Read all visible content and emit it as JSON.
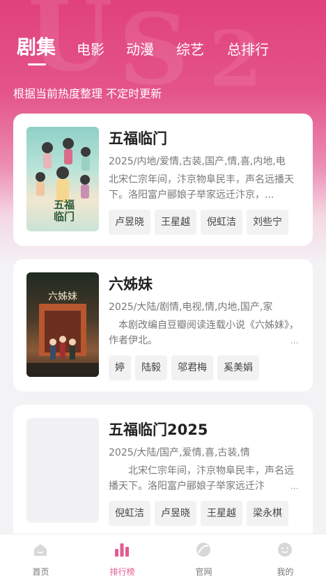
{
  "tabs": [
    {
      "label": "剧集",
      "active": true
    },
    {
      "label": "电影",
      "active": false
    },
    {
      "label": "动漫",
      "active": false
    },
    {
      "label": "综艺",
      "active": false
    },
    {
      "label": "总排行",
      "active": false
    }
  ],
  "subtitle": "根据当前热度整理 不定时更新",
  "accent_color": "#e0417c",
  "cards": [
    {
      "title": "五福临门",
      "meta": "2025/内地/爱情,古装,国产,情,喜,内地,电",
      "description": "北宋仁宗年间，汴京物阜民丰，声名远播天下。洛阳富户郦娘子举家远迁汴京，...",
      "actors": [
        "卢昱晓",
        "王星越",
        "倪虹洁",
        "刘些宁"
      ],
      "poster_text": "五福临门"
    },
    {
      "title": "六姊妹",
      "meta": "2025/大陆/剧情,电视,情,内地,国产,家",
      "description": "本剧改编自豆瓣阅读连载小说《六姊妹》，作者伊北。",
      "ellipsis": "...",
      "actors": [
        "婷",
        "陆毅",
        "邬君梅",
        "奚美娟"
      ],
      "poster_text": "六姊妹"
    },
    {
      "title": "五福临门2025",
      "meta": "2025/大陆/国产,爱情,喜,古装,情",
      "description": "北宋仁宗年间，汴京物阜民丰，声名远播天下。洛阳富户郦娘子举家远迁汴",
      "ellipsis": "...",
      "actors": [
        "倪虹洁",
        "卢昱晓",
        "王星越",
        "梁永棋"
      ]
    }
  ],
  "bottom_nav": [
    {
      "label": "首页",
      "icon": "home-icon",
      "active": false
    },
    {
      "label": "排行榜",
      "icon": "ranking-icon",
      "active": true
    },
    {
      "label": "官网",
      "icon": "official-site-icon",
      "active": false
    },
    {
      "label": "我的",
      "icon": "profile-icon",
      "active": false
    }
  ]
}
